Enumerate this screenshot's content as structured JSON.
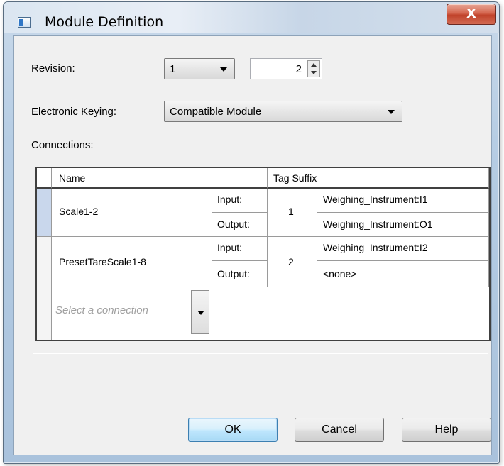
{
  "window": {
    "title": "Module Definition",
    "close_glyph": "X"
  },
  "revision": {
    "label": "Revision:",
    "major": "1",
    "minor": "2"
  },
  "keying": {
    "label": "Electronic Keying:",
    "value": "Compatible Module"
  },
  "connections": {
    "label": "Connections:",
    "headers": {
      "name": "Name",
      "tag_suffix": "Tag Suffix"
    },
    "rows": [
      {
        "name": "Scale1-2",
        "input_label": "Input:",
        "output_label": "Output:",
        "number": "1",
        "input_tag": "Weighing_Instrument:I1",
        "output_tag": "Weighing_Instrument:O1"
      },
      {
        "name": "PresetTareScale1-8",
        "input_label": "Input:",
        "output_label": "Output:",
        "number": "2",
        "input_tag": "Weighing_Instrument:I2",
        "output_tag": "<none>"
      }
    ],
    "new_row_placeholder": "Select a connection"
  },
  "buttons": {
    "ok": "OK",
    "cancel": "Cancel",
    "help": "Help"
  },
  "colors": {
    "selected_row_header": "#c9d7ec",
    "close_button": "#c0432b",
    "default_button_border": "#3c7fb1"
  }
}
